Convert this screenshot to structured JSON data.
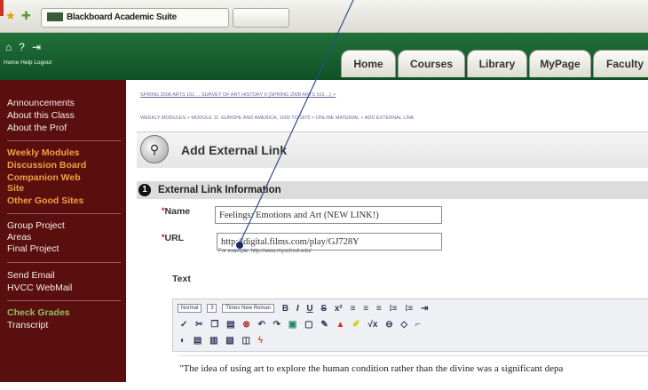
{
  "browser": {
    "tab_title": "Blackboard Academic Suite"
  },
  "header": {
    "icon_labels": "Home  Help  Logout",
    "tabs": [
      "Home",
      "Courses",
      "Library",
      "MyPage",
      "Faculty"
    ]
  },
  "sidebar": {
    "items": [
      "Announcements",
      "About this Class",
      "About the Prof",
      "Weekly Modules",
      "Discussion Board",
      "Companion Web",
      "Site",
      "Other Good Sites",
      "Group Project",
      "Areas",
      "Final Project",
      "Send Email",
      "HVCC WebMail",
      "Check Grades",
      "Transcript"
    ]
  },
  "main": {
    "breadcrumb1": "SPRING 2008 ARTS 101 ... SURVEY OF ART HISTORY II (SPRING 2008 ARTS 101 ...) >",
    "breadcrumb2": "WEEKLY MODULES > MODULE 11: EUROPE AND AMERICA, 1600 TO 1870 > ONLINE MATERIAL > ADD EXTERNAL LINK",
    "title": "Add External Link",
    "section_number": "1",
    "section_title": "External Link Information",
    "name_label": "Name",
    "name_value": "Feelings: Emotions and Art (NEW LINK!)",
    "url_label": "URL",
    "url_value": "http://digital.films.com/play/GJ728Y",
    "url_hint": "For example: http://www.myschool.edu/",
    "text_label": "Text",
    "toolbar": {
      "format": "Normal",
      "size": "3",
      "font": "Times New Roman"
    },
    "content_text": "\"The idea of using art to explore the human condition rather than the divine was a significant depa"
  }
}
